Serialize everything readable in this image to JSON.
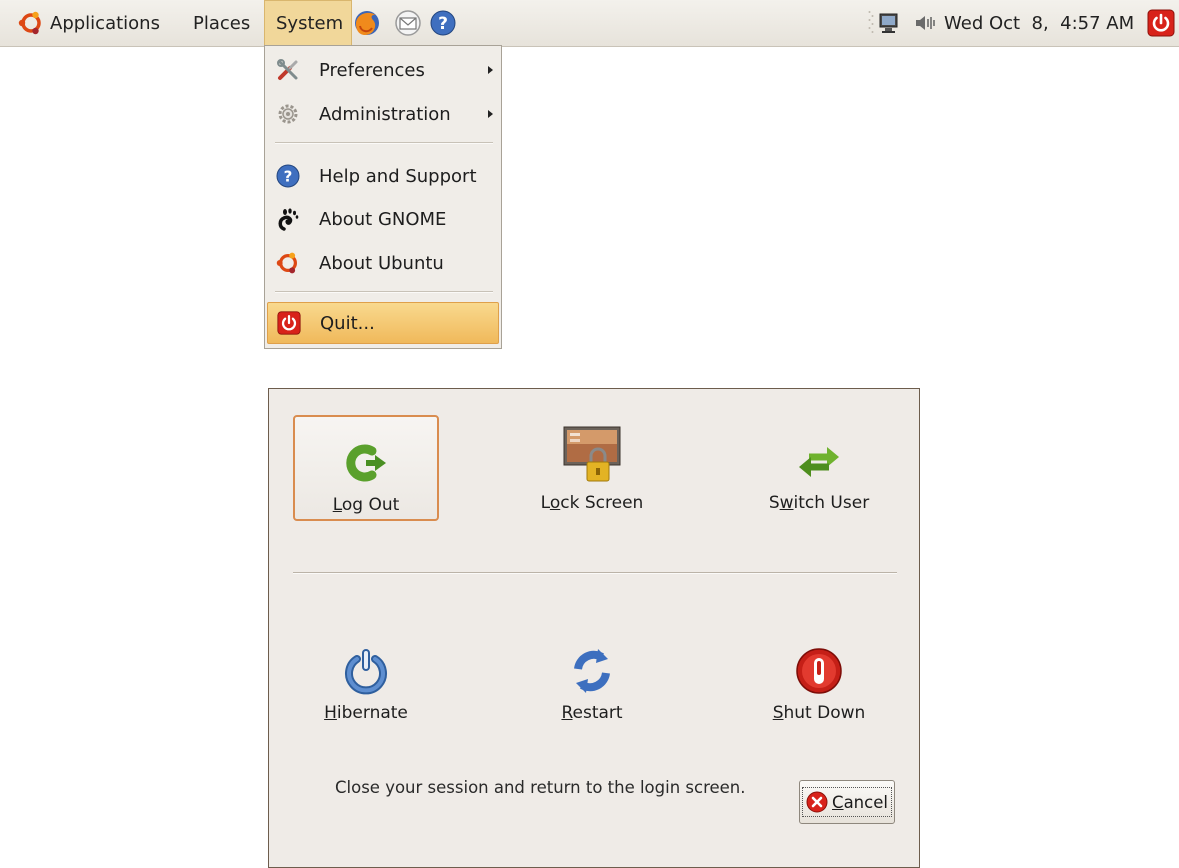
{
  "panel": {
    "menus": [
      {
        "label": "Applications",
        "icon": "ubuntu-logo-icon"
      },
      {
        "label": "Places"
      },
      {
        "label": "System"
      }
    ],
    "launchers": [
      "firefox-icon",
      "mail-icon",
      "help-icon"
    ],
    "tray": [
      "network-icon",
      "volume-icon"
    ],
    "clock": "Wed Oct  8,  4:57 AM",
    "power_icon": "power-icon"
  },
  "system_menu": {
    "items": [
      {
        "label": "Preferences",
        "icon": "preferences-icon",
        "submenu": true
      },
      {
        "label": "Administration",
        "icon": "administration-icon",
        "submenu": true
      },
      {
        "label": "Help and Support",
        "icon": "help-icon"
      },
      {
        "label": "About GNOME",
        "icon": "gnome-foot-icon"
      },
      {
        "label": "About Ubuntu",
        "icon": "ubuntu-logo-icon"
      },
      {
        "label": "Quit...",
        "icon": "quit-icon",
        "highlighted": true
      }
    ]
  },
  "dialog": {
    "actions": [
      {
        "pre": "",
        "ul": "L",
        "post": "og Out",
        "icon": "log-out-icon",
        "selected": true
      },
      {
        "pre": "L",
        "ul": "o",
        "post": "ck Screen",
        "icon": "lock-screen-icon"
      },
      {
        "pre": "S",
        "ul": "w",
        "post": "itch User",
        "icon": "switch-user-icon"
      },
      {
        "pre": "",
        "ul": "H",
        "post": "ibernate",
        "icon": "hibernate-icon"
      },
      {
        "pre": "",
        "ul": "R",
        "post": "estart",
        "icon": "restart-icon"
      },
      {
        "pre": "",
        "ul": "S",
        "post": "hut Down",
        "icon": "shut-down-icon"
      }
    ],
    "description": "Close your session and return to the login screen.",
    "cancel": {
      "ul": "C",
      "post": "ancel",
      "icon": "cancel-icon"
    }
  },
  "colors": {
    "panel_bg": "#e9e5de",
    "menu_bg": "#f0ede8",
    "highlight": "#f0b95b",
    "dialog_bg": "#efebe7",
    "selected_border": "#d98c4f"
  }
}
